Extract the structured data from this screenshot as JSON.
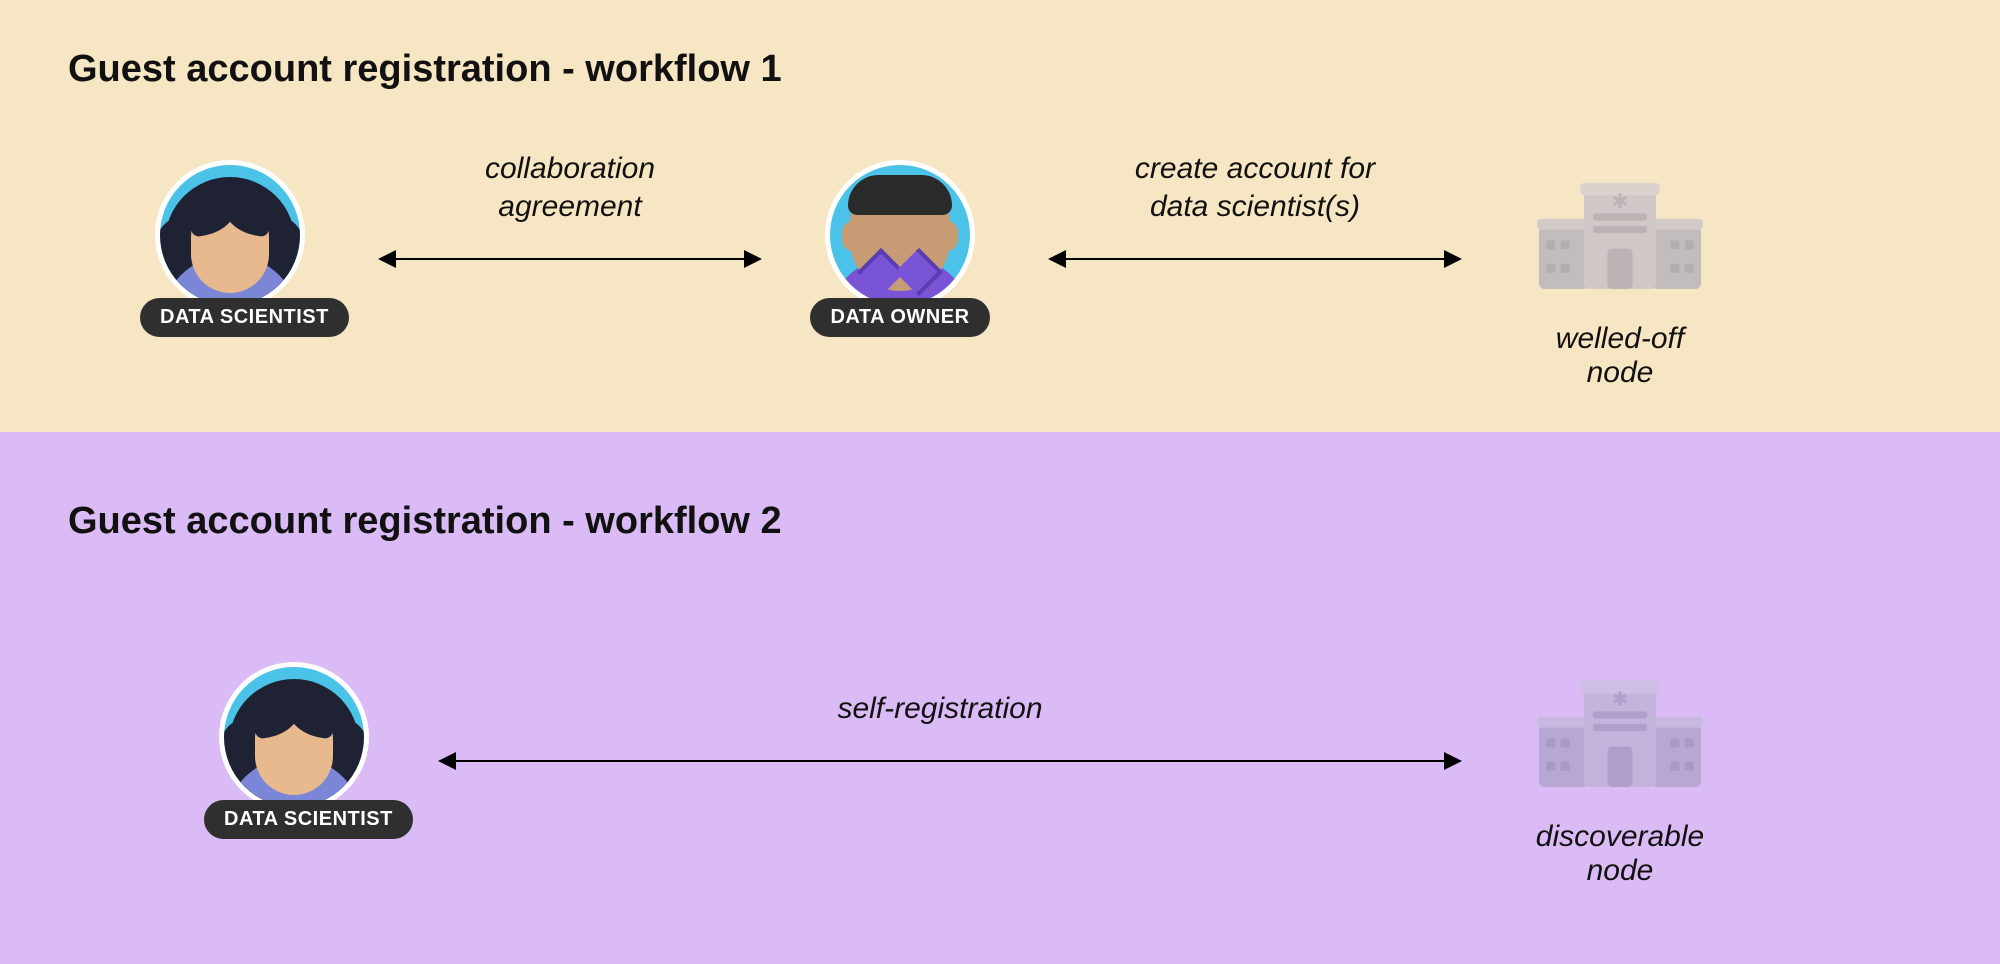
{
  "workflow1": {
    "title": "Guest account registration - workflow 1",
    "scientist_label": "DATA SCIENTIST",
    "owner_label": "DATA OWNER",
    "arrow1_label_line1": "collaboration",
    "arrow1_label_line2": "agreement",
    "arrow2_label_line1": "create account for",
    "arrow2_label_line2": "data scientist(s)",
    "node_label": "welled-off node"
  },
  "workflow2": {
    "title": "Guest account registration - workflow 2",
    "scientist_label": "DATA SCIENTIST",
    "arrow_label": "self-registration",
    "node_label": "discoverable node"
  }
}
